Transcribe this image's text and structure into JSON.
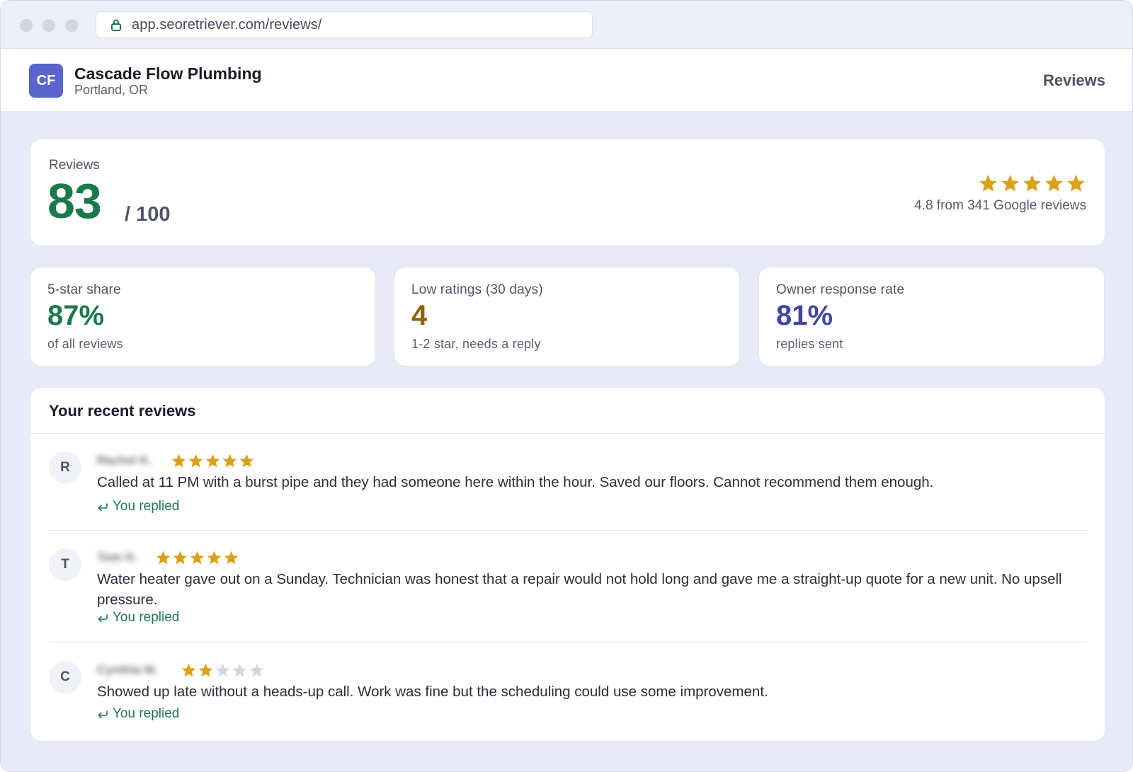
{
  "browser": {
    "url": "app.seoretriever.com/reviews/"
  },
  "header": {
    "avatar_initials": "CF",
    "business_name": "Cascade Flow Plumbing",
    "location": "Portland, OR",
    "nav_label": "Reviews"
  },
  "score": {
    "label": "Reviews",
    "value": "83",
    "total": "/ 100",
    "rating_stars": 5,
    "rating_text": "4.8 from 341 Google reviews"
  },
  "stats": [
    {
      "label": "5-star share",
      "value": "87%",
      "sub": "of all reviews",
      "color": "#1b7a4b"
    },
    {
      "label": "Low ratings (30 days)",
      "value": "4",
      "sub": "1-2 star, needs a reply",
      "color": "#8a6106"
    },
    {
      "label": "Owner response rate",
      "value": "81%",
      "sub": "replies sent",
      "color": "#3f46a6"
    }
  ],
  "recent": {
    "title": "Your recent reviews",
    "reviews": [
      {
        "initial": "R",
        "name": "Rachel K.",
        "stars": 5,
        "text": "Called at 11 PM with a burst pipe and they had someone here within the hour. Saved our floors. Cannot recommend them enough.",
        "status": "You replied"
      },
      {
        "initial": "T",
        "name": "Tom H.",
        "stars": 5,
        "text": "Water heater gave out on a Sunday. Technician was honest that a repair would not hold long and gave me a straight-up quote for a new unit. No upsell pressure.",
        "status": "You replied"
      },
      {
        "initial": "C",
        "name": "Cynthia M.",
        "stars": 2,
        "text": "Showed up late without a heads-up call. Work was fine but the scheduling could use some improvement.",
        "status": "You replied"
      }
    ]
  },
  "colors": {
    "star_filled": "#d9a21b",
    "star_empty": "#d3d6e2",
    "accent_green": "#1b7a4b",
    "avatar_purple": "#5b63cc"
  },
  "icons": {
    "lock": "lock-icon",
    "star": "star-icon",
    "reply": "reply-icon"
  }
}
